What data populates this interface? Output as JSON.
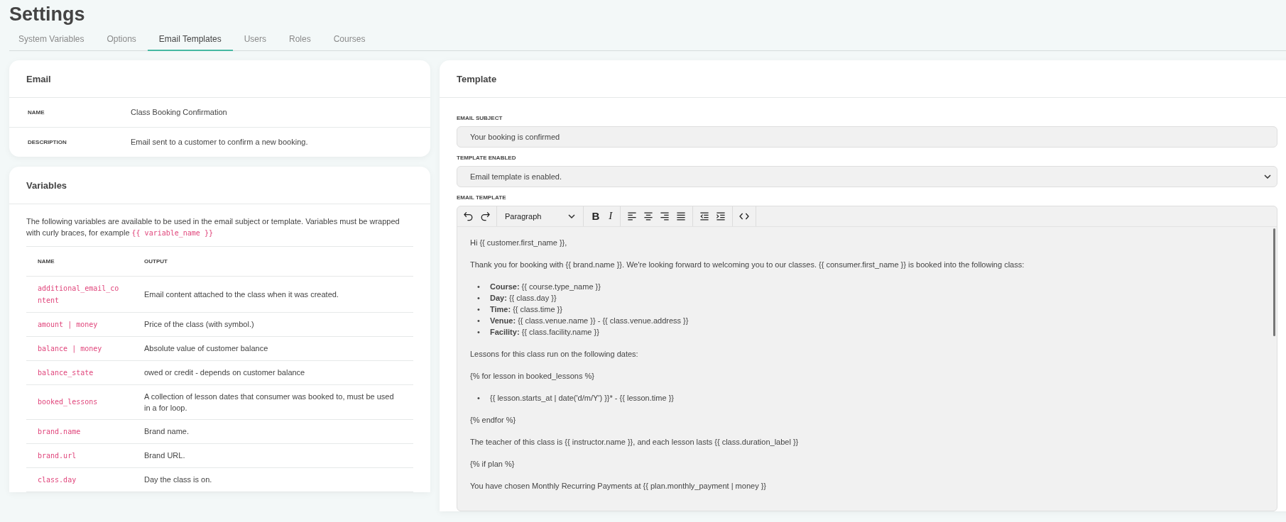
{
  "page": {
    "title": "Settings"
  },
  "tabs": [
    {
      "label": "System Variables",
      "selected": false
    },
    {
      "label": "Options",
      "selected": false
    },
    {
      "label": "Email Templates",
      "selected": true
    },
    {
      "label": "Users",
      "selected": false
    },
    {
      "label": "Roles",
      "selected": false
    },
    {
      "label": "Courses",
      "selected": false
    }
  ],
  "email_card": {
    "title": "Email",
    "rows": [
      {
        "label": "NAME",
        "value": "Class Booking Confirmation"
      },
      {
        "label": "DESCRIPTION",
        "value": "Email sent to a customer to confirm a new booking."
      }
    ]
  },
  "variables_card": {
    "title": "Variables",
    "intro": "The following variables are available to be used in the email subject or template. Variables must be wrapped with curly braces, for example",
    "example": "{{ variable_name }}",
    "table": {
      "columns": [
        "NAME",
        "OUTPUT"
      ],
      "rows": [
        {
          "name": "additional_email_content",
          "output": "Email content attached to the class when it was created."
        },
        {
          "name": "amount | money",
          "output": "Price of the class (with symbol.)"
        },
        {
          "name": "balance | money",
          "output": "Absolute value of customer balance"
        },
        {
          "name": "balance_state",
          "output": "owed or credit - depends on customer balance"
        },
        {
          "name": "booked_lessons",
          "output": "A collection of lesson dates that consumer was booked to, must be used in a for loop."
        },
        {
          "name": "brand.name",
          "output": "Brand name."
        },
        {
          "name": "brand.url",
          "output": "Brand URL."
        },
        {
          "name": "class.day",
          "output": "Day the class is on."
        }
      ]
    }
  },
  "template_card": {
    "title": "Template",
    "subject": {
      "label": "EMAIL SUBJECT",
      "value": "Your booking is confirmed"
    },
    "enabled": {
      "label": "TEMPLATE ENABLED",
      "value": "Email template is enabled."
    },
    "editor": {
      "label": "EMAIL TEMPLATE",
      "toolbar": [
        [
          {
            "kind": "undo"
          },
          {
            "kind": "redo"
          }
        ],
        [
          {
            "kind": "format",
            "label": "Paragraph"
          }
        ],
        [
          {
            "kind": "bold",
            "label": "B"
          },
          {
            "kind": "italic",
            "label": "I"
          }
        ],
        [
          {
            "kind": "align_left"
          },
          {
            "kind": "align_center"
          },
          {
            "kind": "align_right"
          },
          {
            "kind": "align_justify"
          }
        ],
        [
          {
            "kind": "outdent"
          },
          {
            "kind": "indent"
          }
        ],
        [
          {
            "kind": "code"
          }
        ]
      ],
      "content": [
        {
          "kind": "paragraph",
          "text": "Hi {{ customer.first_name }},"
        },
        {
          "kind": "paragraph",
          "text": "Thank you for booking with {{ brand.name }}. We're looking forward to welcoming you to our classes. {{ consumer.first_name }} is booked into the following class:"
        },
        {
          "kind": "list",
          "marker": "•",
          "items": [
            "**Course:** {{ course.type_name }}",
            "**Day:** {{ class.day }}",
            "**Time:** {{ class.time }}",
            "**Venue:** {{ class.venue.name }} - {{ class.venue.address }}",
            "**Facility:** {{ class.facility.name }}"
          ]
        },
        {
          "kind": "paragraph",
          "text": "Lessons for this class run on the following dates:"
        },
        {
          "kind": "paragraph",
          "text": "{% for lesson in booked_lessons %}"
        },
        {
          "kind": "list",
          "marker": "•",
          "items": [
            "{{ lesson.starts_at | date('d/m/Y') }}* - {{ lesson.time }}"
          ]
        },
        {
          "kind": "paragraph",
          "text": "{% endfor %}"
        },
        {
          "kind": "paragraph",
          "text": "The teacher of this class is {{ instructor.name }}, and each lesson lasts {{ class.duration_label }}"
        },
        {
          "kind": "paragraph",
          "text": "{% if plan %}"
        },
        {
          "kind": "paragraph",
          "text": "You have chosen Monthly Recurring Payments at {{ plan.monthly_payment | money }}"
        }
      ]
    }
  }
}
